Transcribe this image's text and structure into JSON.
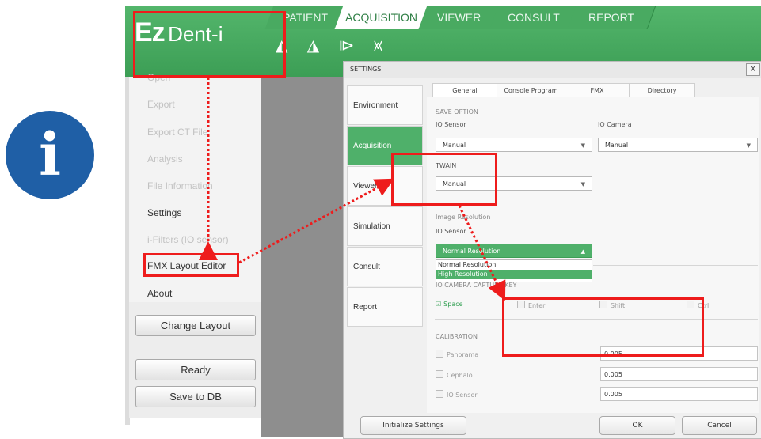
{
  "colors": {
    "brand_green": "#3c9e55",
    "active_green": "#4fb06a",
    "annotation_red": "#ee1c1c",
    "info_blue": "#1f5fa6"
  },
  "info_icon": {
    "glyph": "i"
  },
  "app": {
    "logo_main": "Ez",
    "logo_rest": "Dent-i"
  },
  "top_tabs": [
    "PATIENT",
    "ACQUISITION",
    "VIEWER",
    "CONSULT",
    "REPORT"
  ],
  "toolbar_icons": [
    "rotate-30-icon",
    "rotate-90-icon",
    "flip-horizontal-icon",
    "flip-vertical-icon"
  ],
  "left_menu": {
    "items": [
      "Open",
      "Export",
      "Export CT File",
      "Analysis",
      "File Information",
      "Settings",
      "i-Filters (IO sensor)",
      "FMX Layout Editor",
      "About"
    ],
    "change_layout": "Change Layout",
    "ready": "Ready",
    "save_to_db": "Save to DB"
  },
  "settings": {
    "title": "SETTINGS",
    "close": "X",
    "side_tabs": [
      "Environment",
      "Acquisition",
      "Viewer",
      "Simulation",
      "Consult",
      "Report"
    ],
    "tabs": [
      "General",
      "Console Program",
      "FMX",
      "Directory"
    ],
    "save_option": "SAVE OPTION",
    "io_sensor_label": "IO Sensor",
    "io_camera_label": "IO Camera",
    "io_sensor_value": "Manual",
    "io_camera_value": "Manual",
    "twain_label": "TWAIN",
    "twain_value": "Manual",
    "image_resolution": "Image Resolution",
    "io_sensor_label2": "IO Sensor",
    "resolution_selected": "Normal Resolution",
    "resolution_options": [
      "Normal Resolution",
      "High Resolution"
    ],
    "io_camera_capture": "IO CAMERA CAPTURE KEY",
    "capture_keys": [
      "Space",
      "Enter",
      "Shift",
      "Ctrl"
    ],
    "calibration": "CALIBRATION",
    "calibration_items": [
      {
        "label": "Panorama",
        "value": "0.005"
      },
      {
        "label": "Cephalo",
        "value": "0.005"
      },
      {
        "label": "IO Sensor",
        "value": "0.005"
      }
    ],
    "initialize": "Initialize Settings",
    "ok": "OK",
    "cancel": "Cancel"
  }
}
